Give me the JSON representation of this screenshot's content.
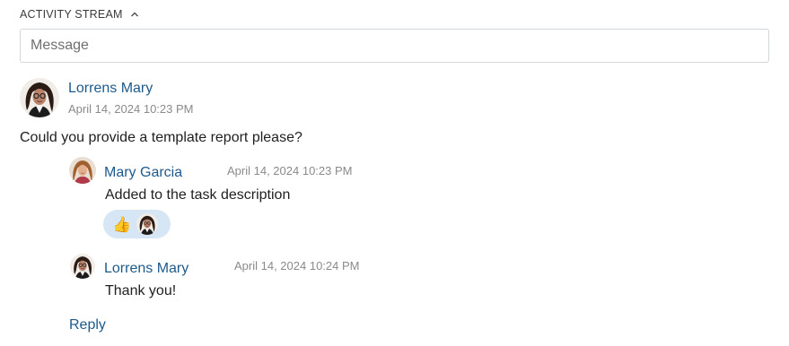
{
  "activity": {
    "title": "ACTIVITY STREAM",
    "toggle_icon": "chevron-up-icon"
  },
  "message_input": {
    "placeholder": "Message",
    "value": ""
  },
  "post": {
    "author": "Lorrens Mary",
    "timestamp": "April 14, 2024 10:23 PM",
    "text": "Could you provide a template report please?"
  },
  "comments": [
    {
      "author": "Mary Garcia",
      "timestamp": "April 14, 2024 10:23 PM",
      "text": "Added to the task description",
      "reaction": {
        "emoji": "👍",
        "icon": "thumbs-up-icon"
      }
    },
    {
      "author": "Lorrens Mary",
      "timestamp": "April 14, 2024 10:24 PM",
      "text": "Thank you!"
    }
  ],
  "actions": {
    "reply": "Reply"
  },
  "colors": {
    "link": "#1d5a8c",
    "timestamp": "#8a8a8a",
    "reaction_bg": "#d6e6f5",
    "input_border": "#d3d6da"
  }
}
